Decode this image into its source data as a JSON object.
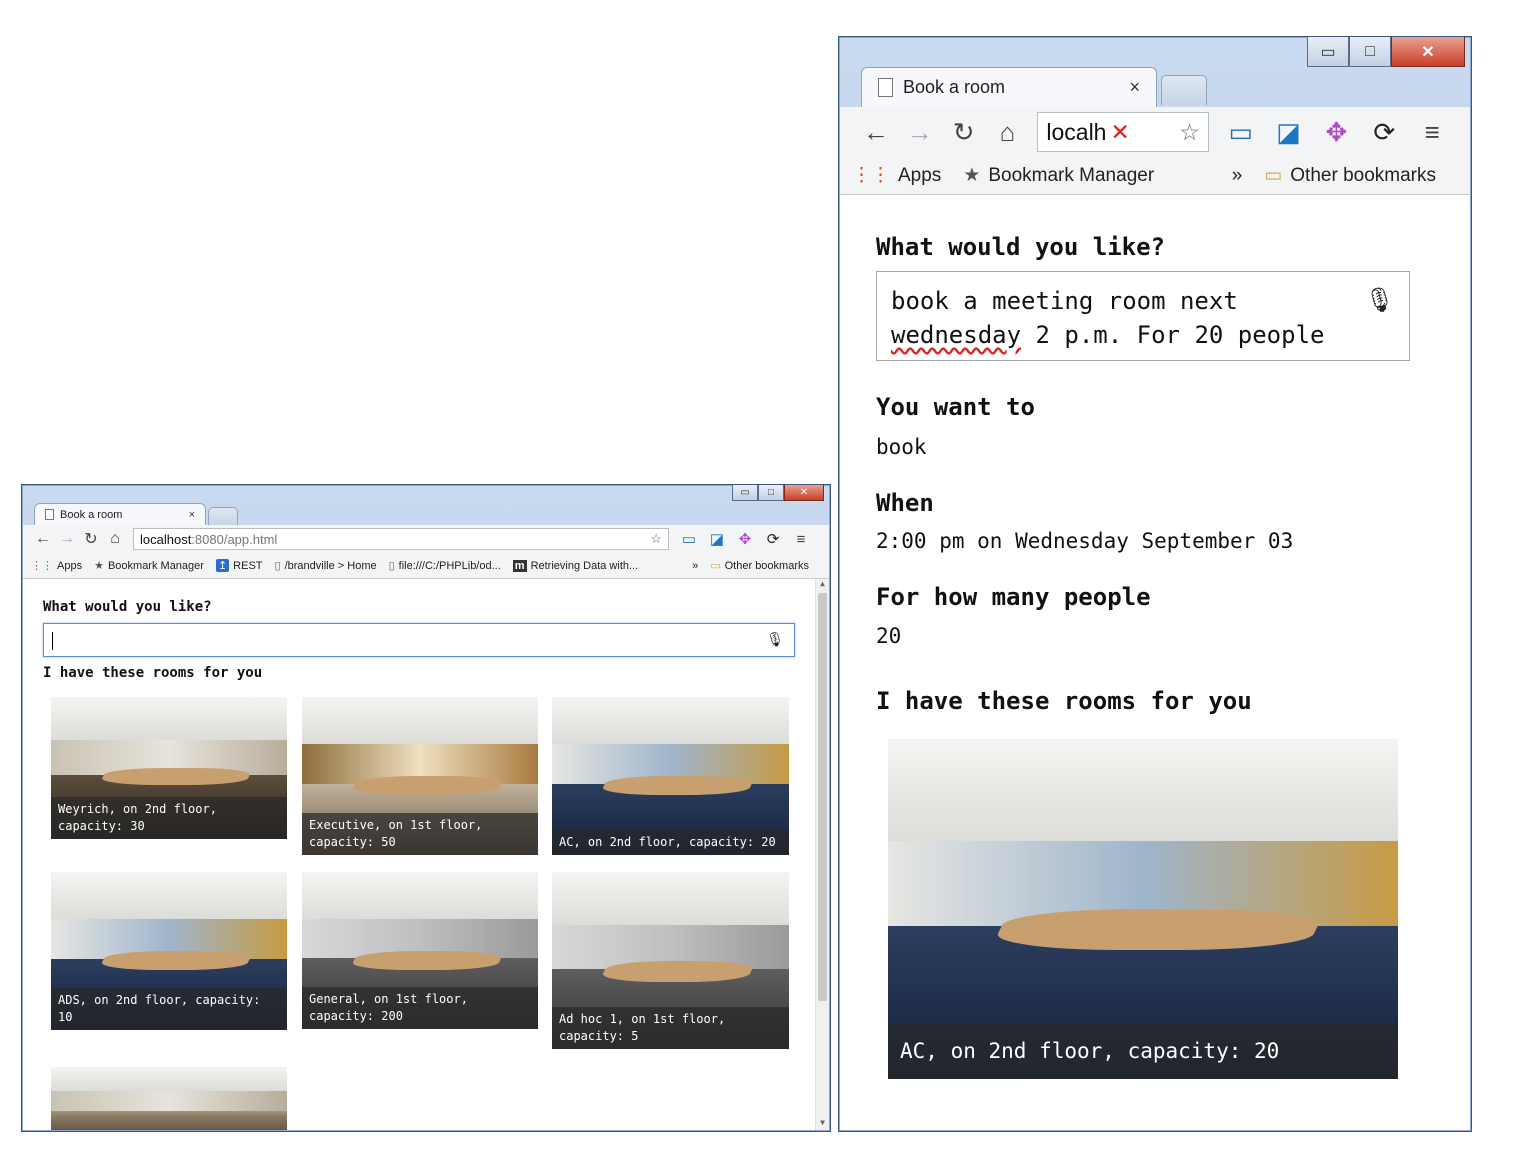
{
  "left_window": {
    "tab_title": "Book a room",
    "tab_close": "×",
    "url_host": "localhost",
    "url_rest": ":8080/app.html",
    "bookmarks": [
      {
        "label": "Apps"
      },
      {
        "label": "Bookmark Manager"
      },
      {
        "label": "REST"
      },
      {
        "label": "/brandville > Home"
      },
      {
        "label": "file:///C:/PHPLib/od..."
      },
      {
        "label": "Retrieving Data with..."
      }
    ],
    "bookmarks_overflow": "»",
    "other_bookmarks": "Other bookmarks",
    "prompt_title": "What would you like?",
    "rooms_title": "I have these rooms for you",
    "rooms": [
      {
        "caption": "Weyrich, on 2nd floor, capacity: 30"
      },
      {
        "caption": "Executive, on 1st floor, capacity: 50"
      },
      {
        "caption": "AC, on 2nd floor, capacity: 20"
      },
      {
        "caption": "ADS, on 2nd floor, capacity: 10"
      },
      {
        "caption": "General, on 1st floor, capacity: 200"
      },
      {
        "caption": "Ad hoc 1, on 1st floor, capacity: 5"
      }
    ]
  },
  "right_window": {
    "tab_title": "Book a room",
    "tab_close": "×",
    "url_text": "localh",
    "bookmarks": [
      {
        "label": "Apps"
      },
      {
        "label": "Bookmark Manager"
      }
    ],
    "bookmarks_overflow": "»",
    "other_bookmarks": "Other bookmarks",
    "prompt_title": "What would you like?",
    "query_part1": "book a meeting room next",
    "query_misspelled": "wednesday",
    "query_part2": " 2 p.m. For 20 people",
    "intent_label": "You want to",
    "intent_value": "book",
    "when_label": "When",
    "when_value": "2:00 pm on Wednesday September 03",
    "people_label": "For how many people",
    "people_value": "20",
    "rooms_title": "I have these rooms for you",
    "room_caption": "AC, on 2nd floor, capacity: 20"
  },
  "icons": {
    "minimize": "▭",
    "maximize": "□",
    "close": "✕",
    "back": "←",
    "forward": "→",
    "reload": "↻",
    "home": "⌂",
    "star": "☆",
    "menu": "≡",
    "mic": "🎙"
  }
}
